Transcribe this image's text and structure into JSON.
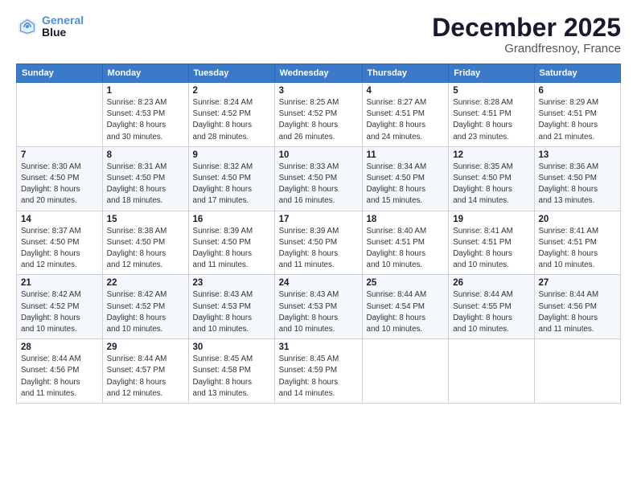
{
  "logo": {
    "line1": "General",
    "line2": "Blue"
  },
  "header": {
    "month": "December 2025",
    "location": "Grandfresnoy, France"
  },
  "weekdays": [
    "Sunday",
    "Monday",
    "Tuesday",
    "Wednesday",
    "Thursday",
    "Friday",
    "Saturday"
  ],
  "weeks": [
    [
      {
        "day": "",
        "info": ""
      },
      {
        "day": "1",
        "info": "Sunrise: 8:23 AM\nSunset: 4:53 PM\nDaylight: 8 hours\nand 30 minutes."
      },
      {
        "day": "2",
        "info": "Sunrise: 8:24 AM\nSunset: 4:52 PM\nDaylight: 8 hours\nand 28 minutes."
      },
      {
        "day": "3",
        "info": "Sunrise: 8:25 AM\nSunset: 4:52 PM\nDaylight: 8 hours\nand 26 minutes."
      },
      {
        "day": "4",
        "info": "Sunrise: 8:27 AM\nSunset: 4:51 PM\nDaylight: 8 hours\nand 24 minutes."
      },
      {
        "day": "5",
        "info": "Sunrise: 8:28 AM\nSunset: 4:51 PM\nDaylight: 8 hours\nand 23 minutes."
      },
      {
        "day": "6",
        "info": "Sunrise: 8:29 AM\nSunset: 4:51 PM\nDaylight: 8 hours\nand 21 minutes."
      }
    ],
    [
      {
        "day": "7",
        "info": "Sunrise: 8:30 AM\nSunset: 4:50 PM\nDaylight: 8 hours\nand 20 minutes."
      },
      {
        "day": "8",
        "info": "Sunrise: 8:31 AM\nSunset: 4:50 PM\nDaylight: 8 hours\nand 18 minutes."
      },
      {
        "day": "9",
        "info": "Sunrise: 8:32 AM\nSunset: 4:50 PM\nDaylight: 8 hours\nand 17 minutes."
      },
      {
        "day": "10",
        "info": "Sunrise: 8:33 AM\nSunset: 4:50 PM\nDaylight: 8 hours\nand 16 minutes."
      },
      {
        "day": "11",
        "info": "Sunrise: 8:34 AM\nSunset: 4:50 PM\nDaylight: 8 hours\nand 15 minutes."
      },
      {
        "day": "12",
        "info": "Sunrise: 8:35 AM\nSunset: 4:50 PM\nDaylight: 8 hours\nand 14 minutes."
      },
      {
        "day": "13",
        "info": "Sunrise: 8:36 AM\nSunset: 4:50 PM\nDaylight: 8 hours\nand 13 minutes."
      }
    ],
    [
      {
        "day": "14",
        "info": "Sunrise: 8:37 AM\nSunset: 4:50 PM\nDaylight: 8 hours\nand 12 minutes."
      },
      {
        "day": "15",
        "info": "Sunrise: 8:38 AM\nSunset: 4:50 PM\nDaylight: 8 hours\nand 12 minutes."
      },
      {
        "day": "16",
        "info": "Sunrise: 8:39 AM\nSunset: 4:50 PM\nDaylight: 8 hours\nand 11 minutes."
      },
      {
        "day": "17",
        "info": "Sunrise: 8:39 AM\nSunset: 4:50 PM\nDaylight: 8 hours\nand 11 minutes."
      },
      {
        "day": "18",
        "info": "Sunrise: 8:40 AM\nSunset: 4:51 PM\nDaylight: 8 hours\nand 10 minutes."
      },
      {
        "day": "19",
        "info": "Sunrise: 8:41 AM\nSunset: 4:51 PM\nDaylight: 8 hours\nand 10 minutes."
      },
      {
        "day": "20",
        "info": "Sunrise: 8:41 AM\nSunset: 4:51 PM\nDaylight: 8 hours\nand 10 minutes."
      }
    ],
    [
      {
        "day": "21",
        "info": "Sunrise: 8:42 AM\nSunset: 4:52 PM\nDaylight: 8 hours\nand 10 minutes."
      },
      {
        "day": "22",
        "info": "Sunrise: 8:42 AM\nSunset: 4:52 PM\nDaylight: 8 hours\nand 10 minutes."
      },
      {
        "day": "23",
        "info": "Sunrise: 8:43 AM\nSunset: 4:53 PM\nDaylight: 8 hours\nand 10 minutes."
      },
      {
        "day": "24",
        "info": "Sunrise: 8:43 AM\nSunset: 4:53 PM\nDaylight: 8 hours\nand 10 minutes."
      },
      {
        "day": "25",
        "info": "Sunrise: 8:44 AM\nSunset: 4:54 PM\nDaylight: 8 hours\nand 10 minutes."
      },
      {
        "day": "26",
        "info": "Sunrise: 8:44 AM\nSunset: 4:55 PM\nDaylight: 8 hours\nand 10 minutes."
      },
      {
        "day": "27",
        "info": "Sunrise: 8:44 AM\nSunset: 4:56 PM\nDaylight: 8 hours\nand 11 minutes."
      }
    ],
    [
      {
        "day": "28",
        "info": "Sunrise: 8:44 AM\nSunset: 4:56 PM\nDaylight: 8 hours\nand 11 minutes."
      },
      {
        "day": "29",
        "info": "Sunrise: 8:44 AM\nSunset: 4:57 PM\nDaylight: 8 hours\nand 12 minutes."
      },
      {
        "day": "30",
        "info": "Sunrise: 8:45 AM\nSunset: 4:58 PM\nDaylight: 8 hours\nand 13 minutes."
      },
      {
        "day": "31",
        "info": "Sunrise: 8:45 AM\nSunset: 4:59 PM\nDaylight: 8 hours\nand 14 minutes."
      },
      {
        "day": "",
        "info": ""
      },
      {
        "day": "",
        "info": ""
      },
      {
        "day": "",
        "info": ""
      }
    ]
  ]
}
